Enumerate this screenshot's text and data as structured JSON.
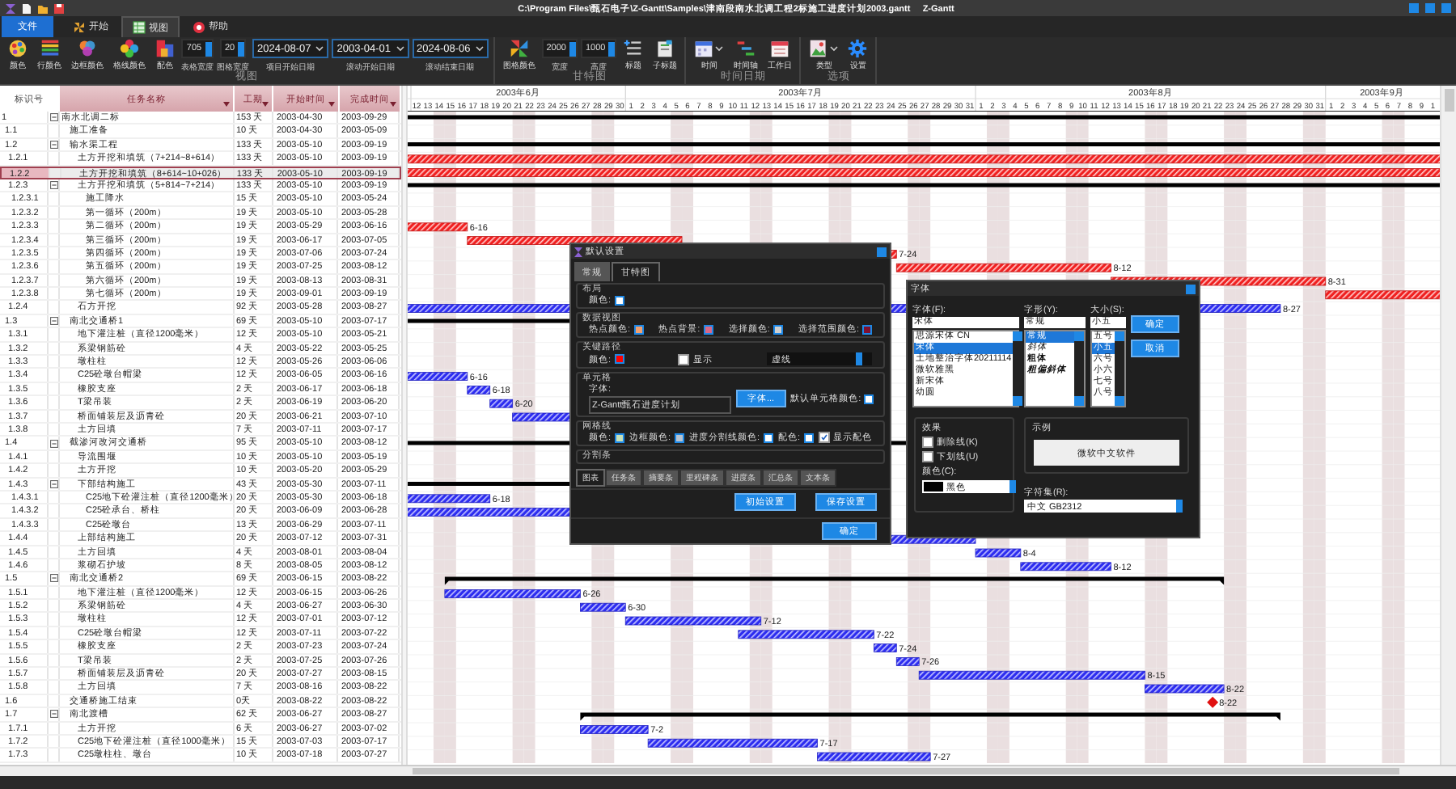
{
  "window": {
    "title": "C:\\Program Files\\甄石电子\\Z-Gantt\\Samples\\津南段南水北调工程2标施工进度计划2003.gantt",
    "app": "Z-Gantt"
  },
  "ribbon": {
    "tabs": [
      {
        "label": "文件",
        "kind": "file",
        "selected": false
      },
      {
        "label": "开始",
        "kind": "tab",
        "selected": false
      },
      {
        "label": "视图",
        "kind": "tab",
        "selected": true
      },
      {
        "label": "帮助",
        "kind": "tab",
        "selected": false
      }
    ],
    "groups": [
      {
        "label": "视图",
        "items": [
          {
            "kind": "button",
            "label": "颜色"
          },
          {
            "kind": "button",
            "label": "行颜色"
          },
          {
            "kind": "button",
            "label": "边框颜色"
          },
          {
            "kind": "button",
            "label": "格线颜色"
          },
          {
            "kind": "button",
            "label": "配色"
          },
          {
            "kind": "spinner",
            "value": "705",
            "label": "表格宽度"
          },
          {
            "kind": "spinner",
            "value": "20",
            "label": "图格宽度"
          },
          {
            "kind": "date",
            "value": "2024-08-07",
            "label": "项目开始日期"
          },
          {
            "kind": "date",
            "value": "2003-04-01",
            "label": "滚动开始日期"
          },
          {
            "kind": "date",
            "value": "2024-08-06",
            "label": "滚动结束日期"
          }
        ]
      },
      {
        "label": "甘特图",
        "items": [
          {
            "kind": "button",
            "label": "图格颜色"
          },
          {
            "kind": "spinner",
            "value": "2000",
            "label": "宽度"
          },
          {
            "kind": "spinner",
            "value": "1000",
            "label": "高度"
          },
          {
            "kind": "button",
            "label": "标题"
          },
          {
            "kind": "button",
            "label": "子标题"
          }
        ]
      },
      {
        "label": "时间日期",
        "items": [
          {
            "kind": "dropdown",
            "label": "时间"
          },
          {
            "kind": "button",
            "label": "时间轴"
          },
          {
            "kind": "button",
            "label": "工作日"
          }
        ]
      },
      {
        "label": "选项",
        "items": [
          {
            "kind": "dropdown",
            "label": "类型"
          },
          {
            "kind": "button",
            "label": "设置"
          }
        ]
      }
    ]
  },
  "table": {
    "columns": [
      "标识号",
      "任务名称",
      "工期",
      "开始时间",
      "完成时间"
    ]
  },
  "timeline": {
    "months": [
      {
        "label": "2003年6月",
        "days": [
          "12",
          "13",
          "14",
          "15",
          "16",
          "17",
          "18",
          "19",
          "20",
          "21",
          "22",
          "23",
          "24",
          "25",
          "26",
          "27",
          "28",
          "29",
          "30"
        ]
      },
      {
        "label": "2003年7月",
        "days": [
          "1",
          "2",
          "3",
          "4",
          "5",
          "6",
          "7",
          "8",
          "9",
          "10",
          "11",
          "12",
          "13",
          "14",
          "15",
          "16",
          "17",
          "18",
          "19",
          "20",
          "21",
          "22",
          "23",
          "24",
          "25",
          "26",
          "27",
          "28",
          "29",
          "30",
          "31"
        ]
      },
      {
        "label": "2003年8月",
        "days": [
          "1",
          "2",
          "3",
          "4",
          "5",
          "6",
          "7",
          "8",
          "9",
          "10",
          "11",
          "12",
          "13",
          "14",
          "15",
          "16",
          "17",
          "18",
          "19",
          "20",
          "21",
          "22",
          "23",
          "24",
          "25",
          "26",
          "27",
          "28",
          "29",
          "30",
          "31"
        ]
      },
      {
        "label": "2003年9月",
        "days": [
          "1",
          "2",
          "3",
          "4",
          "5",
          "6",
          "7",
          "8",
          "9",
          "1"
        ]
      }
    ]
  },
  "tasks": [
    {
      "id": "1",
      "name": "南水北调二标",
      "duration": "153 天",
      "start": "2003-04-30",
      "finish": "2003-09-29",
      "kind": "summary",
      "selected": false,
      "expanded": true,
      "children": [
        {
          "id": "1.1",
          "name": "施工准备",
          "duration": "10 天",
          "start": "2003-04-30",
          "finish": "2003-05-09",
          "kind": "task",
          "selected": false
        },
        {
          "id": "1.2",
          "name": "输水渠工程",
          "duration": "133 天",
          "start": "2003-05-10",
          "finish": "2003-09-19",
          "kind": "summary",
          "selected": false,
          "expanded": true,
          "children": [
            {
              "id": "1.2.1",
              "name": "土方开挖和填筑（7+214~8+614）",
              "duration": "133 天",
              "start": "2003-05-10",
              "finish": "2003-09-19",
              "kind": "critical",
              "selected": false
            },
            {
              "id": "1.2.2",
              "name": "土方开挖和填筑（8+614~10+026）",
              "duration": "133 天",
              "start": "2003-05-10",
              "finish": "2003-09-19",
              "kind": "critical",
              "selected": true
            },
            {
              "id": "1.2.3",
              "name": "土方开挖和填筑（5+814~7+214）",
              "duration": "133 天",
              "start": "2003-05-10",
              "finish": "2003-09-19",
              "kind": "summary",
              "selected": false,
              "expanded": true,
              "children": [
                {
                  "id": "1.2.3.1",
                  "name": "施工降水",
                  "duration": "15 天",
                  "start": "2003-05-10",
                  "finish": "2003-05-24",
                  "kind": "critical",
                  "selected": false
                },
                {
                  "id": "1.2.3.2",
                  "name": "第一循环（200m）",
                  "duration": "19 天",
                  "start": "2003-05-10",
                  "finish": "2003-05-28",
                  "kind": "critical",
                  "selected": false
                },
                {
                  "id": "1.2.3.3",
                  "name": "第二循环（200m）",
                  "duration": "19 天",
                  "start": "2003-05-29",
                  "finish": "2003-06-16",
                  "kind": "critical",
                  "selected": false,
                  "bar_label": "6-16"
                },
                {
                  "id": "1.2.3.4",
                  "name": "第三循环（200m）",
                  "duration": "19 天",
                  "start": "2003-06-17",
                  "finish": "2003-07-05",
                  "kind": "critical",
                  "selected": false
                },
                {
                  "id": "1.2.3.5",
                  "name": "第四循环（200m）",
                  "duration": "19 天",
                  "start": "2003-07-06",
                  "finish": "2003-07-24",
                  "kind": "critical",
                  "selected": false,
                  "bar_label": "7-24"
                },
                {
                  "id": "1.2.3.6",
                  "name": "第五循环（200m）",
                  "duration": "19 天",
                  "start": "2003-07-25",
                  "finish": "2003-08-12",
                  "kind": "critical",
                  "selected": false,
                  "bar_label": "8-12"
                },
                {
                  "id": "1.2.3.7",
                  "name": "第六循环（200m）",
                  "duration": "19 天",
                  "start": "2003-08-13",
                  "finish": "2003-08-31",
                  "kind": "critical",
                  "selected": false,
                  "bar_label": "8-31"
                },
                {
                  "id": "1.2.3.8",
                  "name": "第七循环（200m）",
                  "duration": "19 天",
                  "start": "2003-09-01",
                  "finish": "2003-09-19",
                  "kind": "critical",
                  "selected": false
                }
              ]
            },
            {
              "id": "1.2.4",
              "name": "石方开挖",
              "duration": "92 天",
              "start": "2003-05-28",
              "finish": "2003-08-27",
              "kind": "task",
              "selected": false,
              "bar_label": "8-27"
            }
          ]
        },
        {
          "id": "1.3",
          "name": "南北交通桥1",
          "duration": "69 天",
          "start": "2003-05-10",
          "finish": "2003-07-17",
          "kind": "summary",
          "selected": false,
          "expanded": true,
          "children": [
            {
              "id": "1.3.1",
              "name": "地下灌注桩（直径1200毫米）",
              "duration": "12 天",
              "start": "2003-05-10",
              "finish": "2003-05-21",
              "kind": "task",
              "selected": false
            },
            {
              "id": "1.3.2",
              "name": "系梁钢筋砼",
              "duration": "4 天",
              "start": "2003-05-22",
              "finish": "2003-05-25",
              "kind": "task",
              "selected": false
            },
            {
              "id": "1.3.3",
              "name": "墩柱柱",
              "duration": "12 天",
              "start": "2003-05-26",
              "finish": "2003-06-06",
              "kind": "task",
              "selected": false
            },
            {
              "id": "1.3.4",
              "name": "C25砼墩台帽梁",
              "duration": "12 天",
              "start": "2003-06-05",
              "finish": "2003-06-16",
              "kind": "task",
              "selected": false,
              "bar_label": "6-16"
            },
            {
              "id": "1.3.5",
              "name": "橡胶支座",
              "duration": "2 天",
              "start": "2003-06-17",
              "finish": "2003-06-18",
              "kind": "task",
              "selected": false,
              "bar_label": "6-18"
            },
            {
              "id": "1.3.6",
              "name": "T梁吊装",
              "duration": "2 天",
              "start": "2003-06-19",
              "finish": "2003-06-20",
              "kind": "task",
              "selected": false,
              "bar_label": "6-20"
            },
            {
              "id": "1.3.7",
              "name": "桥面铺装层及沥青砼",
              "duration": "20 天",
              "start": "2003-06-21",
              "finish": "2003-07-10",
              "kind": "task",
              "selected": false
            },
            {
              "id": "1.3.8",
              "name": "土方回填",
              "duration": "7 天",
              "start": "2003-07-11",
              "finish": "2003-07-17",
              "kind": "task",
              "selected": false
            }
          ]
        },
        {
          "id": "1.4",
          "name": "截渗河改河交通桥",
          "duration": "95 天",
          "start": "2003-05-10",
          "finish": "2003-08-12",
          "kind": "summary",
          "selected": false,
          "expanded": true,
          "children": [
            {
              "id": "1.4.1",
              "name": "导流围堰",
              "duration": "10 天",
              "start": "2003-05-10",
              "finish": "2003-05-19",
              "kind": "task",
              "selected": false
            },
            {
              "id": "1.4.2",
              "name": "土方开挖",
              "duration": "10 天",
              "start": "2003-05-20",
              "finish": "2003-05-29",
              "kind": "task",
              "selected": false
            },
            {
              "id": "1.4.3",
              "name": "下部结构施工",
              "duration": "43 天",
              "start": "2003-05-30",
              "finish": "2003-07-11",
              "kind": "summary",
              "selected": false,
              "expanded": true,
              "children": [
                {
                  "id": "1.4.3.1",
                  "name": "C25地下砼灌注桩（直径1200毫米）",
                  "duration": "20 天",
                  "start": "2003-05-30",
                  "finish": "2003-06-18",
                  "kind": "task",
                  "selected": false,
                  "bar_label": "6-18"
                },
                {
                  "id": "1.4.3.2",
                  "name": "C25砼承台、桥柱",
                  "duration": "20 天",
                  "start": "2003-06-09",
                  "finish": "2003-06-28",
                  "kind": "task",
                  "selected": false
                },
                {
                  "id": "1.4.3.3",
                  "name": "C25砼墩台",
                  "duration": "13 天",
                  "start": "2003-06-29",
                  "finish": "2003-07-11",
                  "kind": "task",
                  "selected": false
                }
              ]
            },
            {
              "id": "1.4.4",
              "name": "上部结构施工",
              "duration": "20 天",
              "start": "2003-07-12",
              "finish": "2003-07-31",
              "kind": "task",
              "selected": false
            },
            {
              "id": "1.4.5",
              "name": "土方回填",
              "duration": "4 天",
              "start": "2003-08-01",
              "finish": "2003-08-04",
              "kind": "task",
              "selected": false,
              "bar_label": "8-4"
            },
            {
              "id": "1.4.6",
              "name": "浆砌石护坡",
              "duration": "8 天",
              "start": "2003-08-05",
              "finish": "2003-08-12",
              "kind": "task",
              "selected": false,
              "bar_label": "8-12"
            }
          ]
        },
        {
          "id": "1.5",
          "name": "南北交通桥2",
          "duration": "69 天",
          "start": "2003-06-15",
          "finish": "2003-08-22",
          "kind": "summary",
          "selected": false,
          "expanded": true,
          "children": [
            {
              "id": "1.5.1",
              "name": "地下灌注桩（直径1200毫米）",
              "duration": "12 天",
              "start": "2003-06-15",
              "finish": "2003-06-26",
              "kind": "task",
              "selected": false,
              "bar_label": "6-26"
            },
            {
              "id": "1.5.2",
              "name": "系梁钢筋砼",
              "duration": "4 天",
              "start": "2003-06-27",
              "finish": "2003-06-30",
              "kind": "task",
              "selected": false,
              "bar_label": "6-30"
            },
            {
              "id": "1.5.3",
              "name": "墩柱柱",
              "duration": "12 天",
              "start": "2003-07-01",
              "finish": "2003-07-12",
              "kind": "task",
              "selected": false,
              "bar_label": "7-12"
            },
            {
              "id": "1.5.4",
              "name": "C25砼墩台帽梁",
              "duration": "12 天",
              "start": "2003-07-11",
              "finish": "2003-07-22",
              "kind": "task",
              "selected": false,
              "bar_label": "7-22"
            },
            {
              "id": "1.5.5",
              "name": "橡胶支座",
              "duration": "2 天",
              "start": "2003-07-23",
              "finish": "2003-07-24",
              "kind": "task",
              "selected": false,
              "bar_label": "7-24"
            },
            {
              "id": "1.5.6",
              "name": "T梁吊装",
              "duration": "2 天",
              "start": "2003-07-25",
              "finish": "2003-07-26",
              "kind": "task",
              "selected": false,
              "bar_label": "7-26"
            },
            {
              "id": "1.5.7",
              "name": "桥面铺装层及沥青砼",
              "duration": "20 天",
              "start": "2003-07-27",
              "finish": "2003-08-15",
              "kind": "task",
              "selected": false,
              "bar_label": "8-15"
            },
            {
              "id": "1.5.8",
              "name": "土方回填",
              "duration": "7 天",
              "start": "2003-08-16",
              "finish": "2003-08-22",
              "kind": "task",
              "selected": false,
              "bar_label": "8-22"
            }
          ]
        },
        {
          "id": "1.6",
          "name": "交通桥施工结束",
          "duration": "0天",
          "start": "2003-08-22",
          "finish": "2003-08-22",
          "kind": "milestone",
          "selected": false,
          "bar_label": "8-22"
        },
        {
          "id": "1.7",
          "name": "南北渡槽",
          "duration": "62 天",
          "start": "2003-06-27",
          "finish": "2003-08-27",
          "kind": "summary",
          "selected": false,
          "expanded": true,
          "children": [
            {
              "id": "1.7.1",
              "name": "土方开挖",
              "duration": "6 天",
              "start": "2003-06-27",
              "finish": "2003-07-02",
              "kind": "task",
              "selected": false,
              "bar_label": "7-2"
            },
            {
              "id": "1.7.2",
              "name": "C25地下砼灌注桩（直径1000毫米）",
              "duration": "15 天",
              "start": "2003-07-03",
              "finish": "2003-07-17",
              "kind": "task",
              "selected": false,
              "bar_label": "7-17"
            },
            {
              "id": "1.7.3",
              "name": "C25墩柱柱、墩台",
              "duration": "10 天",
              "start": "2003-07-18",
              "finish": "2003-07-27",
              "kind": "task",
              "selected": false,
              "bar_label": "7-27"
            }
          ]
        }
      ]
    }
  ],
  "settings_dialog": {
    "title": "默认设置",
    "tabs": [
      {
        "label": "常规",
        "selected": false
      },
      {
        "label": "甘特图",
        "selected": true
      }
    ],
    "sections": [
      {
        "title": "布局",
        "fields": [
          {
            "kind": "color",
            "label": "颜色:",
            "color": "#ffffff"
          }
        ]
      },
      {
        "title": "数据视图",
        "fields": [
          {
            "kind": "color",
            "label": "热点颜色:",
            "color": "#f0a070"
          },
          {
            "kind": "color",
            "label": "热点背景:",
            "color": "#d86888"
          },
          {
            "kind": "color",
            "label": "选择颜色:",
            "color": "#d0d0d0"
          },
          {
            "kind": "color",
            "label": "选择范围颜色:",
            "color": "#801030"
          }
        ]
      },
      {
        "title": "关键路径",
        "fields": [
          {
            "kind": "color",
            "label": "颜色:",
            "color": "#ff0000"
          },
          {
            "kind": "check",
            "label": "显示",
            "checked": false
          },
          {
            "kind": "select",
            "value": "虚线"
          }
        ]
      },
      {
        "title": "单元格",
        "fields": [
          {
            "kind": "font",
            "label": "字体:",
            "value": "Z-Gantt甄石进度计划"
          },
          {
            "kind": "button",
            "label": "字体..."
          },
          {
            "kind": "color",
            "label": "默认单元格颜色:",
            "color": "#ffffff"
          }
        ]
      },
      {
        "title": "网格线",
        "fields": [
          {
            "kind": "color",
            "label": "颜色:",
            "color": "#c8e0b8"
          },
          {
            "kind": "color",
            "label": "边框颜色:",
            "color": "#b8c4d0"
          },
          {
            "kind": "color",
            "label": "进度分割线颜色:",
            "color": "#ffffff"
          },
          {
            "kind": "color",
            "label": "配色:",
            "color": "#ffffff"
          },
          {
            "kind": "check",
            "label": "显示配色",
            "checked": true
          }
        ]
      },
      {
        "title": "分割条"
      }
    ],
    "bottom_tabs": [
      {
        "label": "图表",
        "selected": true
      },
      {
        "label": "任务条",
        "selected": false
      },
      {
        "label": "摘要条",
        "selected": false
      },
      {
        "label": "里程碑条",
        "selected": false
      },
      {
        "label": "进度条",
        "selected": false
      },
      {
        "label": "汇总条",
        "selected": false
      },
      {
        "label": "文本条",
        "selected": false
      }
    ],
    "buttons": [
      "初始设置",
      "保存设置"
    ],
    "ok": "确定"
  },
  "font_dialog": {
    "title": "字体",
    "font": {
      "label": "字体(F):",
      "value": "宋体",
      "options": [
        {
          "label": "思源宋体 CN",
          "selected": false
        },
        {
          "label": "宋体",
          "selected": true
        },
        {
          "label": "土地整治字体20211114",
          "selected": false
        },
        {
          "label": "微软雅黑",
          "selected": false
        },
        {
          "label": "新宋体",
          "selected": false
        },
        {
          "label": "幼圆",
          "selected": false
        }
      ]
    },
    "style": {
      "label": "字形(Y):",
      "value": "常规",
      "options": [
        {
          "label": "常规",
          "kind": "regular",
          "selected": true
        },
        {
          "label": "斜体",
          "kind": "italic",
          "selected": false
        },
        {
          "label": "粗体",
          "kind": "bold",
          "selected": false
        },
        {
          "label": "粗偏斜体",
          "kind": "bolditalic",
          "selected": false
        }
      ]
    },
    "size": {
      "label": "大小(S):",
      "value": "小五",
      "options": [
        {
          "label": "五号",
          "selected": false
        },
        {
          "label": "小五",
          "selected": true
        },
        {
          "label": "六号",
          "selected": false
        },
        {
          "label": "小六",
          "selected": false
        },
        {
          "label": "七号",
          "selected": false
        },
        {
          "label": "八号",
          "selected": false
        }
      ]
    },
    "buttons": [
      "确定",
      "取消"
    ],
    "effects": {
      "title": "效果",
      "checks": [
        {
          "label": "删除线(K)",
          "checked": false
        },
        {
          "label": "下划线(U)",
          "checked": false
        }
      ],
      "color_label": "颜色(C):",
      "color": {
        "value": "黑色",
        "color": "#000000"
      }
    },
    "sample": {
      "title": "示例",
      "text": "微软中文软件"
    },
    "charset": {
      "label": "字符集(R):",
      "value": "中文 GB2312"
    }
  }
}
